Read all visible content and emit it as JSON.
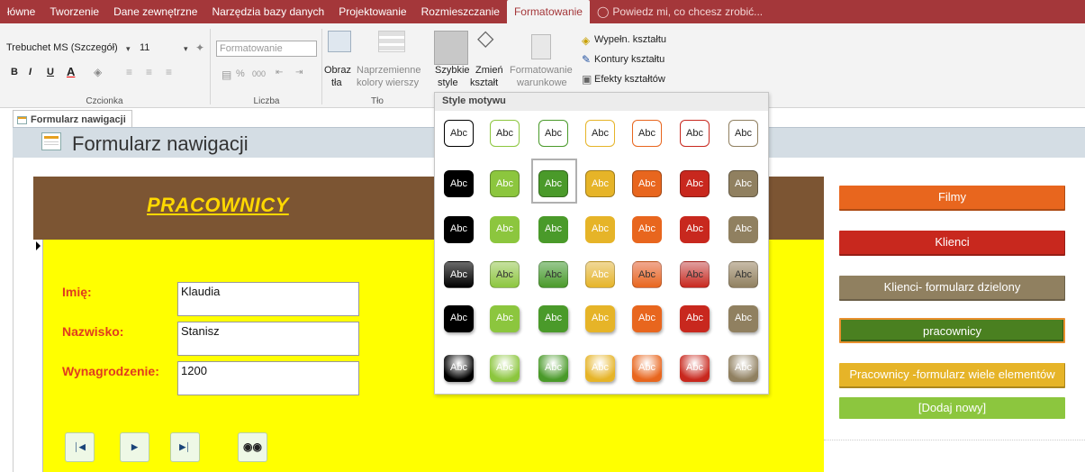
{
  "ribbon_tabs": [
    "łówne",
    "Tworzenie",
    "Dane zewnętrzne",
    "Narzędzia bazy danych",
    "Projektowanie",
    "Rozmieszczanie",
    "Formatowanie"
  ],
  "tell_me": "Powiedz mi, co chcesz zrobić...",
  "ribbon": {
    "font_name": "Trebuchet MS (Szczegół)",
    "font_size": "11",
    "number_format": "Formatowanie",
    "bold": "B",
    "italic": "I",
    "underline": "U",
    "font_color_letter": "A",
    "percent": "%",
    "thousands": "000",
    "groups": {
      "font": "Czcionka",
      "number": "Liczba",
      "background": "Tło"
    },
    "bg_image_label": "Obraz",
    "bg_image_sub": "tła",
    "alt_colors_label": "Naprzemienne",
    "alt_colors_sub": "kolory wierszy",
    "quick_styles_label": "Szybkie",
    "quick_styles_sub": "style",
    "change_shape_label": "Zmień",
    "change_shape_sub": "kształt",
    "cond_format_label": "Formatowanie",
    "cond_format_sub": "warunkowe",
    "shape_fill": "Wypełn. kształtu",
    "shape_outline": "Kontury kształtu",
    "shape_effects": "Efekty kształtów"
  },
  "document_tab": "Formularz nawigacji",
  "form_title": "Formularz nawigacji",
  "form": {
    "header": "PRACOWNICY",
    "fields": [
      {
        "label": "Imię:",
        "value": "Klaudia"
      },
      {
        "label": "Nazwisko:",
        "value": "Stanisz"
      },
      {
        "label": "Wynagrodzenie:",
        "value": "1200"
      }
    ]
  },
  "nav_items": [
    "Filmy",
    "Klienci",
    "Klienci- formularz dzielony",
    "pracownicy",
    "Pracownicy -formularz wiele elementów",
    "[Dodaj nowy]"
  ],
  "gallery": {
    "title": "Style motywu",
    "swatch_label": "Abc",
    "colors": [
      "#000000",
      "#8cc63e",
      "#4a9a2a",
      "#e6b428",
      "#e8661e",
      "#c8281e",
      "#908060"
    ]
  }
}
